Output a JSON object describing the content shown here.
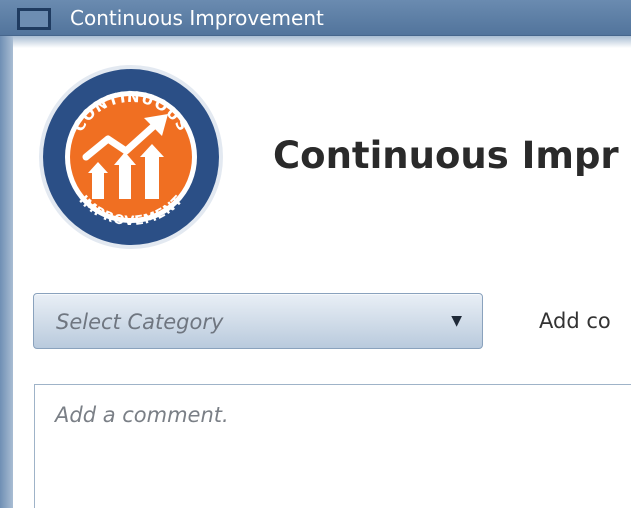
{
  "window": {
    "title": "Continuous Improvement",
    "icon": "window-icon"
  },
  "logo": {
    "top_text": "CONTINUOUS",
    "bottom_text": "IMPROVEMENT",
    "colors": {
      "ring": "#2b4f86",
      "center": "#f06f22",
      "arrows": "#ffffff"
    }
  },
  "page": {
    "heading": "Continuous Impr"
  },
  "category": {
    "placeholder": "Select Category",
    "icon": "dropdown-arrow-icon"
  },
  "add_label": "Add co",
  "comment": {
    "placeholder": "Add a comment."
  }
}
